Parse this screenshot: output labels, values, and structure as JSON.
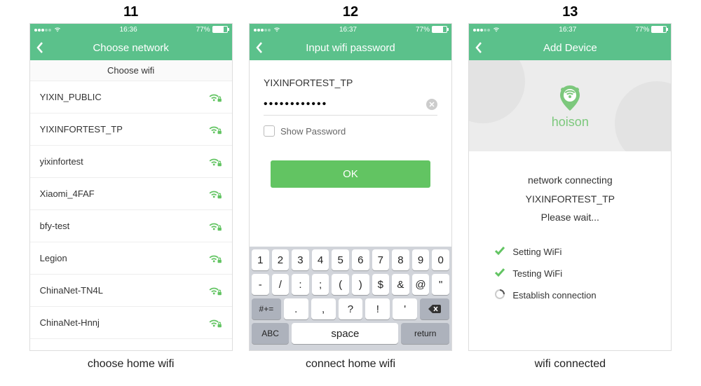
{
  "status": {
    "time1": "16:36",
    "time2": "16:37",
    "time3": "16:37",
    "battery": "77%"
  },
  "steps": {
    "n1": "11",
    "n2": "12",
    "n3": "13"
  },
  "screen1": {
    "navTitle": "Choose network",
    "sectionHeader": "Choose wifi",
    "networks": [
      "YIXIN_PUBLIC",
      "YIXINFORTEST_TP",
      "yixinfortest",
      "Xiaomi_4FAF",
      "bfy-test",
      "Legion",
      "ChinaNet-TN4L",
      "ChinaNet-Hnnj"
    ],
    "caption": "choose home wifi"
  },
  "screen2": {
    "navTitle": "Input wifi password",
    "ssid": "YIXINFORTEST_TP",
    "passwordMasked": "••••••••••••",
    "showLabel": "Show Password",
    "okLabel": "OK",
    "keyboard": {
      "row1": [
        "1",
        "2",
        "3",
        "4",
        "5",
        "6",
        "7",
        "8",
        "9",
        "0"
      ],
      "row2": [
        "-",
        "/",
        ":",
        ";",
        "(",
        ")",
        "$",
        "&",
        "@",
        "\""
      ],
      "row3": [
        ".",
        ",",
        "?",
        "!",
        "'"
      ],
      "symKey": "#+=",
      "abc": "ABC",
      "space": "space",
      "ret": "return"
    },
    "caption": "connect home wifi"
  },
  "screen3": {
    "navTitle": "Add Device",
    "brand": "hoison",
    "line1": "network connecting",
    "line2": "YIXINFORTEST_TP",
    "line3": "Please wait...",
    "s1": "Setting WiFi",
    "s2": "Testing WiFi",
    "s3": "Establish connection",
    "caption": "wifi connected"
  }
}
